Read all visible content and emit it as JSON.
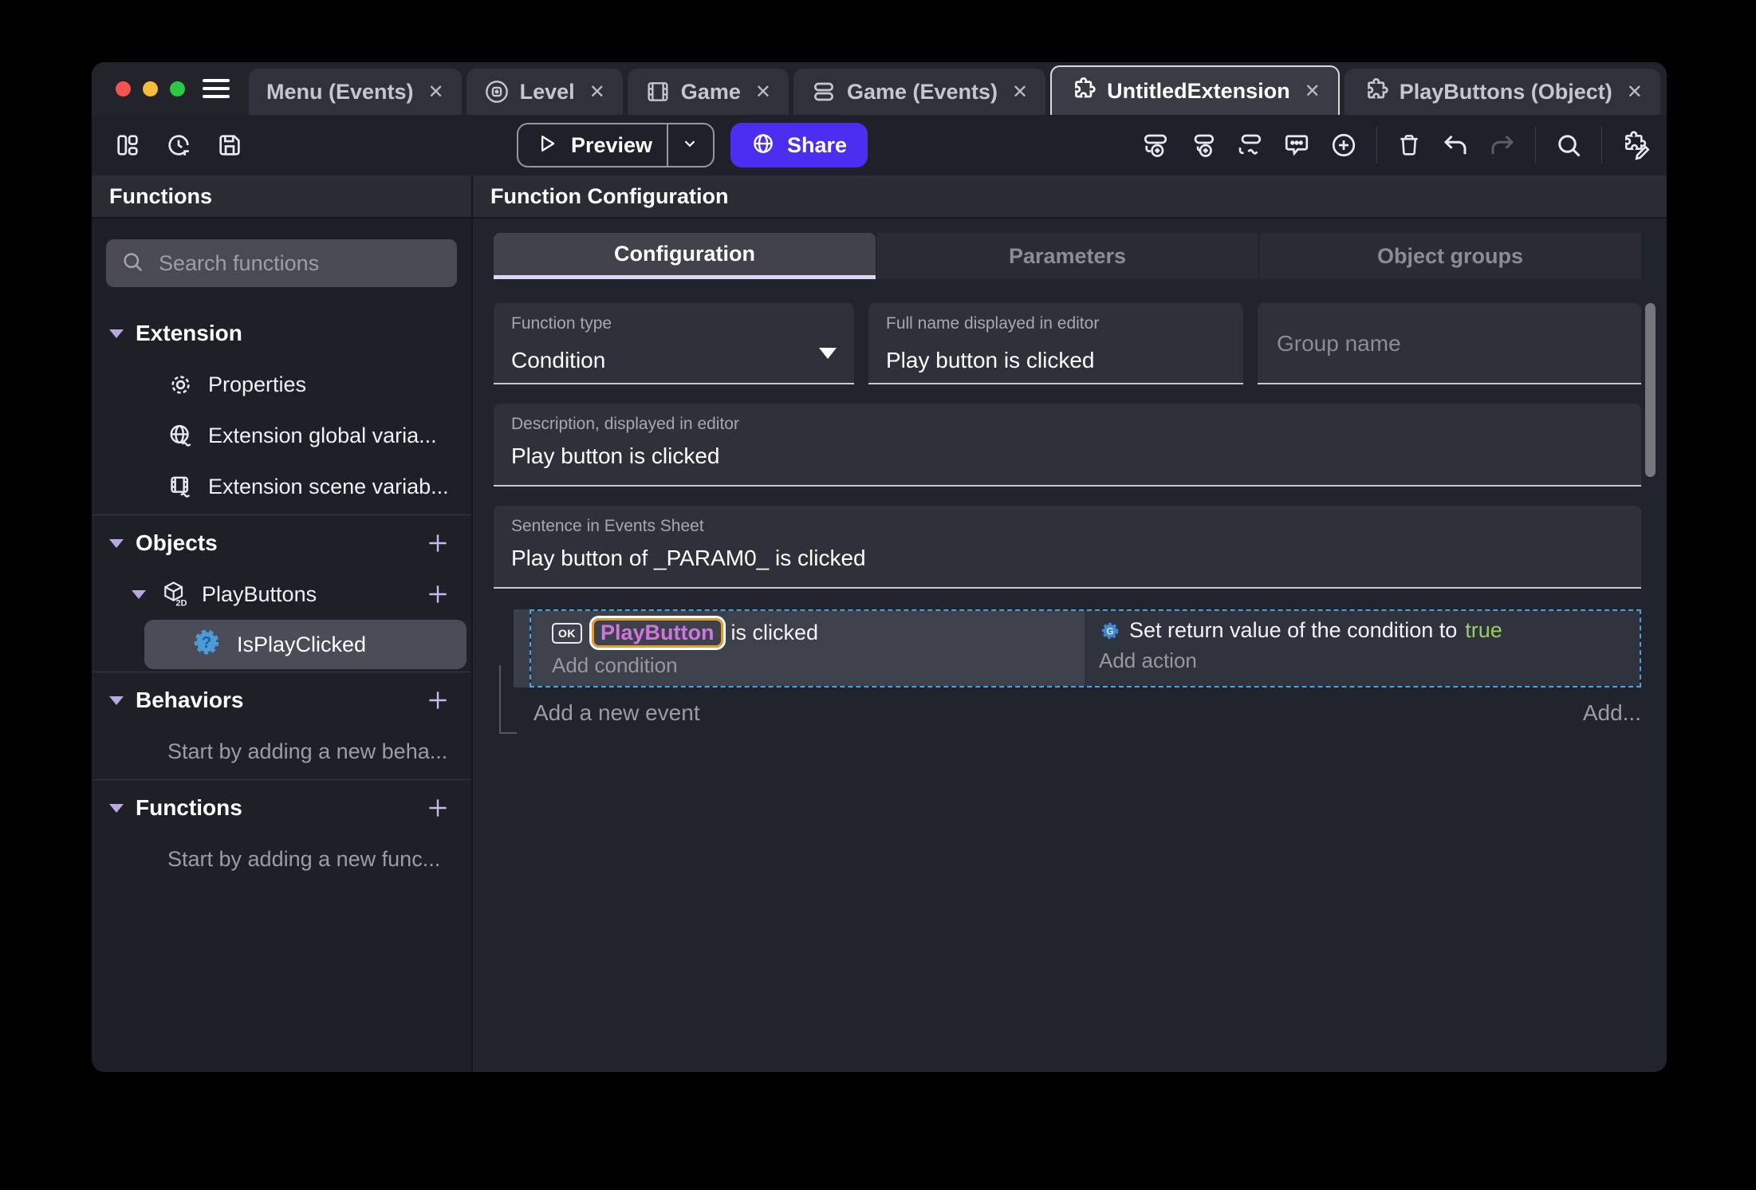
{
  "colors": {
    "traffic_red": "#f4544d",
    "traffic_yellow": "#f5bd39",
    "traffic_green": "#2fc844",
    "share_purple": "#4c2ef0",
    "accent_lavender": "#b9a8e0",
    "object_name_violet": "#cf76dd",
    "param_border_orange": "#de9b3c",
    "boolean_true_green": "#9ccc64",
    "selection_blue": "#4aa3e0"
  },
  "icons": {
    "close_glyph": "✕"
  },
  "titlebar": {
    "tabs": [
      {
        "label": "Menu (Events)"
      },
      {
        "label": "Level"
      },
      {
        "label": "Game"
      },
      {
        "label": "Game (Events)"
      },
      {
        "label": "UntitledExtension"
      },
      {
        "label": "PlayButtons (Object)"
      }
    ]
  },
  "toolbar": {
    "preview_label": "Preview",
    "share_label": "Share"
  },
  "sidebar": {
    "title": "Functions",
    "search_placeholder": "Search functions",
    "extension_section": {
      "label": "Extension",
      "items": [
        {
          "label": "Properties"
        },
        {
          "label": "Extension global varia..."
        },
        {
          "label": "Extension scene variab..."
        }
      ]
    },
    "objects_section": {
      "label": "Objects",
      "object_label": "PlayButtons",
      "object_type_badge": "2D",
      "function_label": "IsPlayClicked"
    },
    "behaviors_section": {
      "label": "Behaviors",
      "empty_label": "Start by adding a new beha..."
    },
    "functions_section": {
      "label": "Functions",
      "empty_label": "Start by adding a new func..."
    }
  },
  "main": {
    "title": "Function Configuration",
    "tabs": [
      {
        "label": "Configuration"
      },
      {
        "label": "Parameters"
      },
      {
        "label": "Object groups"
      }
    ],
    "function_type": {
      "label": "Function type",
      "value": "Condition"
    },
    "full_name": {
      "label": "Full name displayed in editor",
      "value": "Play button is clicked"
    },
    "group_name": {
      "placeholder": "Group name"
    },
    "description": {
      "label": "Description, displayed in editor",
      "value": "Play button is clicked"
    },
    "sentence": {
      "label": "Sentence in Events Sheet",
      "value": "Play button of _PARAM0_ is clicked"
    },
    "events": {
      "condition": {
        "object_badge": "OK",
        "object_name": "PlayButton",
        "text": "is clicked",
        "add_label": "Add condition"
      },
      "action": {
        "gear_letter": "G",
        "text": "Set return value of the condition to",
        "value": "true",
        "add_label": "Add action"
      },
      "add_event_label": "Add a new event",
      "add_button_label": "Add..."
    }
  }
}
